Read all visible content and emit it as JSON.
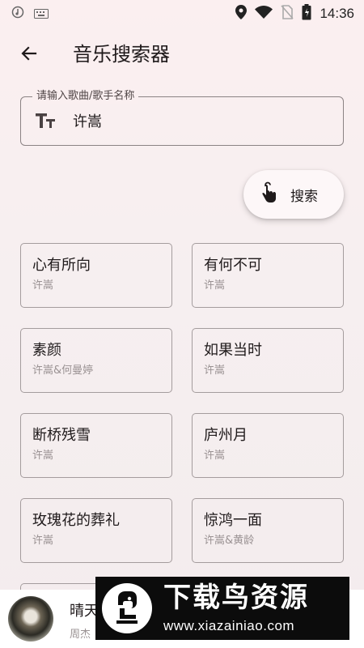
{
  "status_bar": {
    "time": "14:36",
    "icons": [
      "music-note-icon",
      "keyboard-icon",
      "location-icon",
      "wifi-icon",
      "no-sim-icon",
      "battery-icon"
    ]
  },
  "app_bar": {
    "title": "音乐搜索器",
    "back_icon": "arrow-back-icon"
  },
  "search": {
    "label": "请输入歌曲/歌手名称",
    "value": "许嵩",
    "icon": "text-fields-icon"
  },
  "search_button": {
    "label": "搜索",
    "icon": "touch-hand-icon"
  },
  "songs": [
    {
      "title": "心有所向",
      "artist": "许嵩"
    },
    {
      "title": "有何不可",
      "artist": "许嵩"
    },
    {
      "title": "素颜",
      "artist": "许嵩&何曼婷"
    },
    {
      "title": "如果当时",
      "artist": "许嵩"
    },
    {
      "title": "断桥残雪",
      "artist": "许嵩"
    },
    {
      "title": "庐州月",
      "artist": "许嵩"
    },
    {
      "title": "玫瑰花的葬礼",
      "artist": "许嵩"
    },
    {
      "title": "惊鸿一面",
      "artist": "许嵩&黄龄"
    }
  ],
  "player": {
    "title": "晴天",
    "artist": "周杰"
  },
  "watermark": {
    "title": "下载鸟资源",
    "url": "www.xiazainiao.com"
  }
}
